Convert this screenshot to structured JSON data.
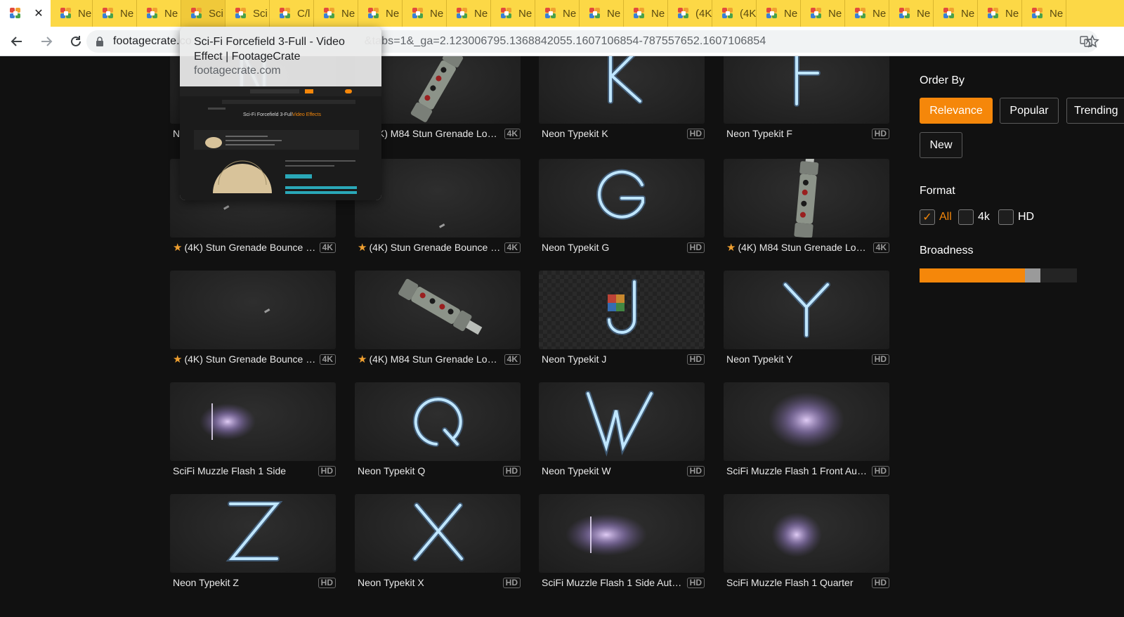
{
  "browser": {
    "tabs": [
      {
        "label": "",
        "active": true,
        "close": "✕"
      },
      {
        "label": "Ne"
      },
      {
        "label": "Ne"
      },
      {
        "label": "Ne"
      },
      {
        "label": "Sci",
        "hover": true
      },
      {
        "label": "Sci"
      },
      {
        "label": "C/l"
      },
      {
        "label": "Ne"
      },
      {
        "label": "Ne"
      },
      {
        "label": "Ne"
      },
      {
        "label": "Ne"
      },
      {
        "label": "Ne"
      },
      {
        "label": "Ne"
      },
      {
        "label": "Ne"
      },
      {
        "label": "Ne"
      },
      {
        "label": "(4K"
      },
      {
        "label": "(4K"
      },
      {
        "label": "Ne"
      },
      {
        "label": "Ne"
      },
      {
        "label": "Ne"
      },
      {
        "label": "Ne"
      },
      {
        "label": "Ne"
      },
      {
        "label": "Ne"
      },
      {
        "label": "Ne"
      }
    ],
    "url_host": "footagecrate.co",
    "url_rest": "&tabs=1&_ga=2.123006795.1368842055.1607106854-787557652.1607106854"
  },
  "preview": {
    "title": "Sci-Fi Forcefield 3-Full - Video Effect | FootageCrate",
    "domain": "footagecrate.com",
    "shot_heading": "Sci-Fi Forcefield 3-Full",
    "shot_sub": "Video Effects"
  },
  "grid": [
    {
      "title": "Neon Typekit N",
      "badge": "HD",
      "star": false,
      "art": "letter",
      "glyph": "N"
    },
    {
      "title": "(4K) M84 Stun Grenade Loop…",
      "badge": "4K",
      "star": true,
      "art": "grenade-diag"
    },
    {
      "title": "Neon Typekit K",
      "badge": "HD",
      "star": false,
      "art": "letter",
      "glyph": "K"
    },
    {
      "title": "Neon Typekit F",
      "badge": "HD",
      "star": false,
      "art": "letter",
      "glyph": "F"
    },
    {
      "title": "(4K) Stun Grenade Bounce In…",
      "badge": "4K",
      "star": true,
      "art": "speck"
    },
    {
      "title": "(4K) Stun Grenade Bounce In…",
      "badge": "4K",
      "star": true,
      "art": "speck2"
    },
    {
      "title": "Neon Typekit G",
      "badge": "HD",
      "star": false,
      "art": "letter",
      "glyph": "G"
    },
    {
      "title": "(4K) M84 Stun Grenade Loop…",
      "badge": "4K",
      "star": true,
      "art": "grenade-vert"
    },
    {
      "title": "(4K) Stun Grenade Bounce In…",
      "badge": "4K",
      "star": true,
      "art": "speck3"
    },
    {
      "title": "(4K) M84 Stun Grenade Loop…",
      "badge": "4K",
      "star": true,
      "art": "grenade-flat"
    },
    {
      "title": "Neon Typekit J",
      "badge": "HD",
      "star": false,
      "art": "letter-checker",
      "glyph": "J"
    },
    {
      "title": "Neon Typekit Y",
      "badge": "HD",
      "star": false,
      "art": "letter",
      "glyph": "Y"
    },
    {
      "title": "SciFi Muzzle Flash 1 Side",
      "badge": "HD",
      "star": false,
      "art": "flash-side"
    },
    {
      "title": "Neon Typekit Q",
      "badge": "HD",
      "star": false,
      "art": "letter",
      "glyph": "Q"
    },
    {
      "title": "Neon Typekit W",
      "badge": "HD",
      "star": false,
      "art": "letter",
      "glyph": "W"
    },
    {
      "title": "SciFi Muzzle Flash 1 Front Auto…",
      "badge": "HD",
      "star": false,
      "art": "flash-front"
    },
    {
      "title": "Neon Typekit Z",
      "badge": "HD",
      "star": false,
      "art": "letter",
      "glyph": "Z"
    },
    {
      "title": "Neon Typekit X",
      "badge": "HD",
      "star": false,
      "art": "letter",
      "glyph": "X"
    },
    {
      "title": "SciFi Muzzle Flash 1 Side Auto…",
      "badge": "HD",
      "star": false,
      "art": "flash-side-auto"
    },
    {
      "title": "SciFi Muzzle Flash 1 Quarter",
      "badge": "HD",
      "star": false,
      "art": "flash-quarter"
    }
  ],
  "sidebar": {
    "order_by_label": "Order By",
    "order_options": [
      "Relevance",
      "Popular",
      "Trending",
      "New"
    ],
    "order_selected": "Relevance",
    "format_label": "Format",
    "format_options": [
      {
        "label": "All",
        "checked": true
      },
      {
        "label": "4k",
        "checked": false
      },
      {
        "label": "HD",
        "checked": false
      }
    ],
    "broadness_label": "Broadness",
    "broadness_value": 0.67
  },
  "colors": {
    "accent": "#f5870a",
    "tabstrip": "#fcd846",
    "neon": "#bfe6ff"
  }
}
